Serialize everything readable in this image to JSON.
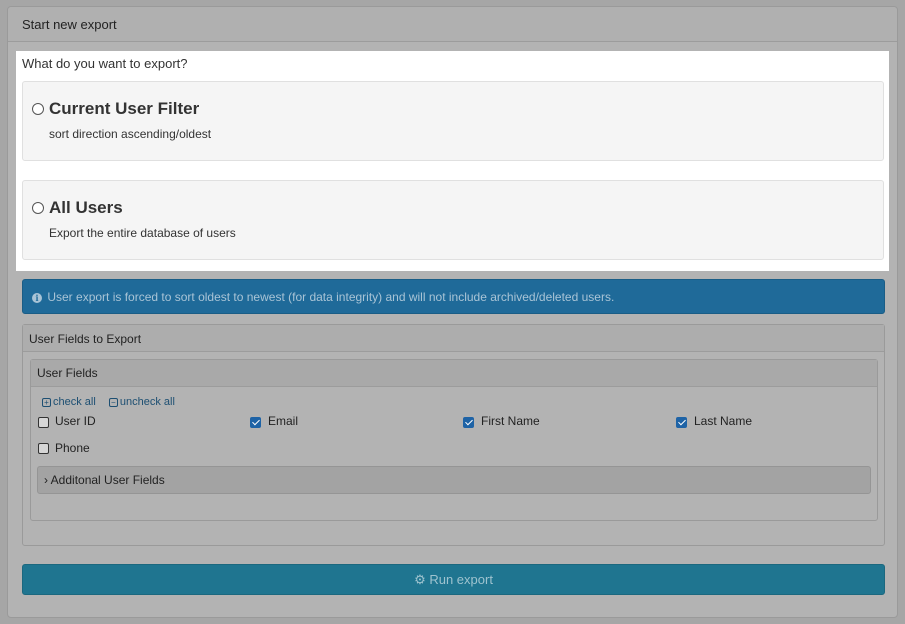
{
  "panel": {
    "title": "Start new export"
  },
  "export_choice": {
    "question": "What do you want to export?",
    "options": [
      {
        "title": "Current User Filter",
        "description": "sort direction ascending/oldest"
      },
      {
        "title": "All Users",
        "description": "Export the entire database of users"
      }
    ]
  },
  "info": {
    "icon": "info-circle-icon",
    "text": "User export is forced to sort oldest to newest (for data integrity) and will not include archived/deleted users."
  },
  "fields_panel": {
    "title": "User Fields to Export",
    "inner_title": "User Fields",
    "check_all": "check all",
    "uncheck_all": "uncheck all",
    "fields": [
      {
        "label": "User ID",
        "checked": false
      },
      {
        "label": "Email",
        "checked": true
      },
      {
        "label": "First Name",
        "checked": true
      },
      {
        "label": "Last Name",
        "checked": true
      },
      {
        "label": "Phone",
        "checked": false
      }
    ],
    "additional": "Additonal User Fields"
  },
  "run_button": {
    "label": "Run export",
    "icon": "cogs-icon"
  },
  "colors": {
    "info_bg": "#1f6a99",
    "button_bg": "#1f7590",
    "checkbox_checked": "#1e63a6"
  }
}
